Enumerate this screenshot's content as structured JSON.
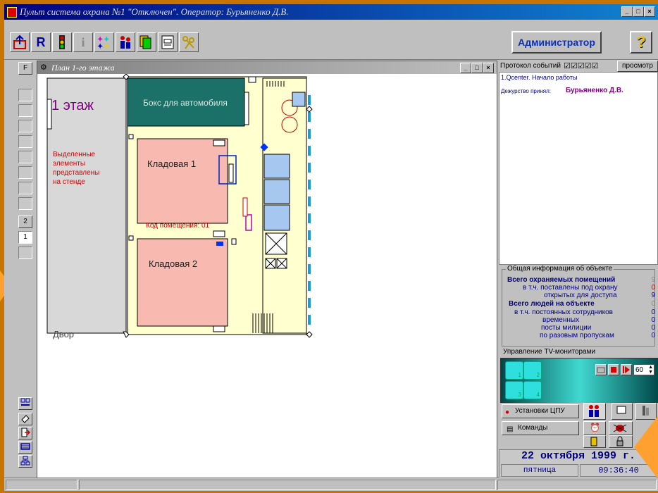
{
  "window": {
    "title": "Пульт система охрана №1 \"Отключен\". Оператор: Бурьяненко Д.В.",
    "min": "_",
    "max": "□",
    "close": "×"
  },
  "toolbar": {
    "r_label": "R",
    "info_label": "i",
    "admin_label": "Администратор",
    "help_label": "?"
  },
  "left_panel": {
    "f_label": "F",
    "floor2_label": "2",
    "floor1_label": "1"
  },
  "plan": {
    "title": "План 1-го этажа",
    "min": "_",
    "max": "□",
    "close": "×",
    "floor_label": "1 этаж",
    "note": [
      "Выделенные",
      "элементы",
      "представлены",
      "на стенде"
    ],
    "yard_label": "Двор",
    "garage_label": "Бокс для автомобиля",
    "store1_label": "Кладовая 1",
    "store1_code": "Код помещения: 01",
    "store2_label": "Кладовая 2"
  },
  "events": {
    "header": "Протокол событий",
    "checks": "☑☑☑☑☑",
    "view_button": "просмотр",
    "line1": "1.Qcenter. Начало работы",
    "duty_label": "Дежурство принял:",
    "duty_name": "Бурьяненко Д.В."
  },
  "general": {
    "title": "Общая информация об объекте",
    "rows": [
      {
        "label": "Всего охраняемых помещений",
        "value": "9"
      },
      {
        "label": "в т.ч. поставлены под охрану",
        "value": "0"
      },
      {
        "label": "открытых для доступа",
        "value": "9"
      },
      {
        "label": "Всего людей на объекте",
        "value": "0"
      },
      {
        "label": "в т.ч. постоянных сотрудников",
        "value": "0"
      },
      {
        "label": "временных",
        "value": "0"
      },
      {
        "label": "посты милиции",
        "value": "0"
      },
      {
        "label": "по разовым пропускам",
        "value": "0"
      }
    ]
  },
  "tv": {
    "title": "Управление TV-мониторами",
    "cells": [
      "1",
      "2",
      "3",
      "4"
    ],
    "interval": "60"
  },
  "controls": {
    "cpu_settings": "Установки ЦПУ",
    "commands": "Команды"
  },
  "datetime": {
    "date": "22 октября 1999 г.",
    "weekday": "пятница",
    "time": "09:36:40"
  },
  "colors": {
    "background": "#c87500",
    "titlebar": "#000080",
    "garage": "#1b7068",
    "store": "#f7b9b0",
    "corridor": "#ffffd0",
    "cabin": "#a6c8f0",
    "tv": "#2de0dd",
    "accent": "#800080"
  }
}
